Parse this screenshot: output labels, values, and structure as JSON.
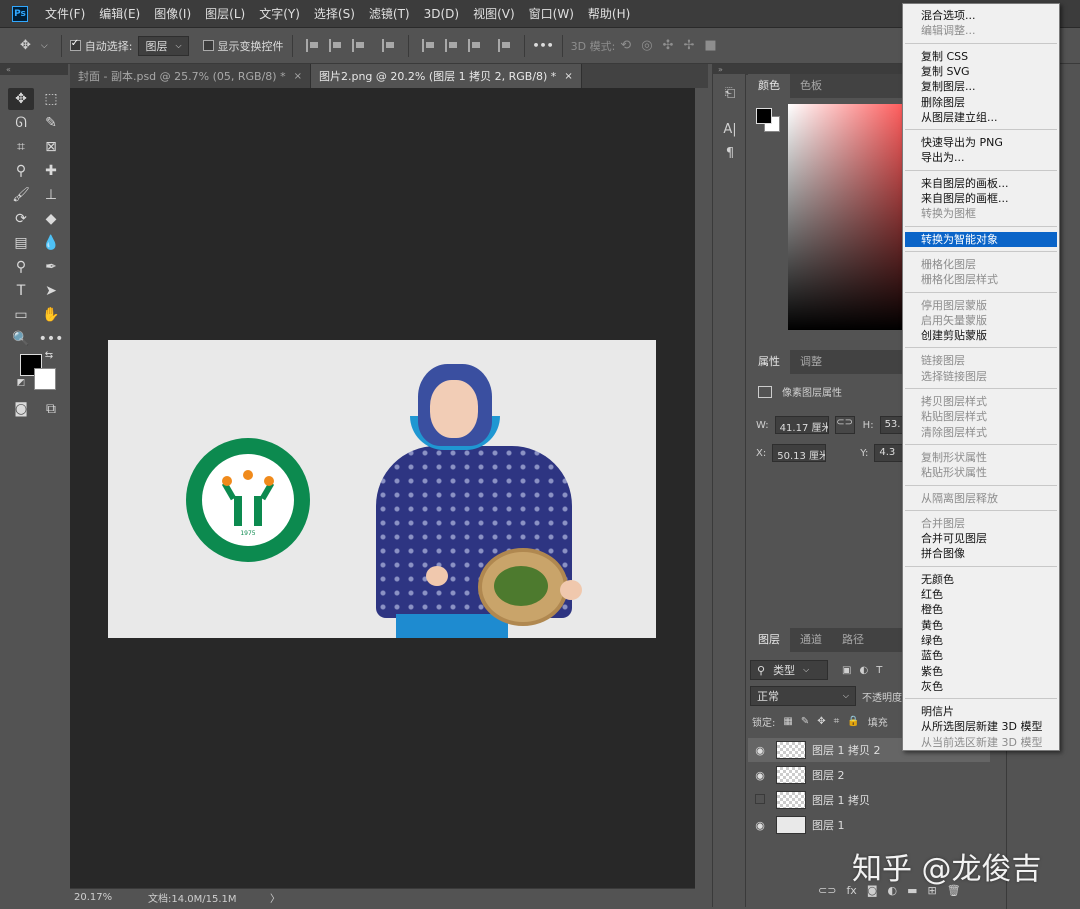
{
  "app": {
    "logo_text": "Ps"
  },
  "menubar": {
    "items": [
      "文件(F)",
      "编辑(E)",
      "图像(I)",
      "图层(L)",
      "文字(Y)",
      "选择(S)",
      "滤镜(T)",
      "3D(D)",
      "视图(V)",
      "窗口(W)",
      "帮助(H)"
    ]
  },
  "options": {
    "auto_select_label": "自动选择:",
    "auto_select_checked": true,
    "target_value": "图层",
    "show_transform_label": "显示变换控件",
    "show_transform_checked": false,
    "more_label": "•••",
    "mode_3d_label": "3D 模式:"
  },
  "tabs": [
    {
      "label": "封面 - 副本.psd @ 25.7% (05, RGB/8) *",
      "close": "×",
      "active": false
    },
    {
      "label": "图片2.png @ 20.2% (图层 1 拷贝 2, RGB/8) *",
      "close": "×",
      "active": true
    }
  ],
  "canvas": {
    "seal_year": "1975"
  },
  "status": {
    "zoom": "20.17%",
    "doc_size": "文档:14.0M/15.1M",
    "arrow": "〉"
  },
  "color_panel": {
    "tabs": [
      "颜色",
      "色板"
    ]
  },
  "props_panel": {
    "tabs": [
      "属性",
      "调整"
    ],
    "title": "像素图层属性",
    "w_label": "W:",
    "w_value": "41.17 厘米",
    "h_label": "H:",
    "h_value": "53.",
    "x_label": "X:",
    "x_value": "50.13 厘米",
    "y_label": "Y:",
    "y_value": "4.3"
  },
  "layers_panel": {
    "tabs": [
      "图层",
      "通道",
      "路径"
    ],
    "filter_value": "类型",
    "blend_mode": "正常",
    "opacity_label": "不透明度",
    "lock_label": "锁定:",
    "fill_label": "填充",
    "layers": [
      {
        "name": "图层 1 拷贝 2",
        "visible": true,
        "selected": true
      },
      {
        "name": "图层 2",
        "visible": true,
        "selected": false
      },
      {
        "name": "图层 1 拷贝",
        "visible": false,
        "selected": false
      },
      {
        "name": "图层 1",
        "visible": true,
        "selected": false
      }
    ]
  },
  "context_menu": {
    "items": [
      {
        "label": "混合选项...",
        "disabled": false
      },
      {
        "label": "编辑调整...",
        "disabled": true
      },
      {
        "sep": true
      },
      {
        "label": "复制 CSS",
        "disabled": false
      },
      {
        "label": "复制 SVG",
        "disabled": false
      },
      {
        "label": "复制图层...",
        "disabled": false
      },
      {
        "label": "删除图层",
        "disabled": false
      },
      {
        "label": "从图层建立组...",
        "disabled": false
      },
      {
        "sep": true
      },
      {
        "label": "快速导出为 PNG",
        "disabled": false
      },
      {
        "label": "导出为...",
        "disabled": false
      },
      {
        "sep": true
      },
      {
        "label": "来自图层的画板...",
        "disabled": false
      },
      {
        "label": "来自图层的画框...",
        "disabled": false
      },
      {
        "label": "转换为图框",
        "disabled": true
      },
      {
        "sep": true
      },
      {
        "label": "转换为智能对象",
        "disabled": false,
        "highlighted": true
      },
      {
        "sep": true
      },
      {
        "label": "栅格化图层",
        "disabled": true
      },
      {
        "label": "栅格化图层样式",
        "disabled": true
      },
      {
        "sep": true
      },
      {
        "label": "停用图层蒙版",
        "disabled": true
      },
      {
        "label": "启用矢量蒙版",
        "disabled": true
      },
      {
        "label": "创建剪贴蒙版",
        "disabled": false
      },
      {
        "sep": true
      },
      {
        "label": "链接图层",
        "disabled": true
      },
      {
        "label": "选择链接图层",
        "disabled": true
      },
      {
        "sep": true
      },
      {
        "label": "拷贝图层样式",
        "disabled": true
      },
      {
        "label": "粘贴图层样式",
        "disabled": true
      },
      {
        "label": "清除图层样式",
        "disabled": true
      },
      {
        "sep": true
      },
      {
        "label": "复制形状属性",
        "disabled": true
      },
      {
        "label": "粘贴形状属性",
        "disabled": true
      },
      {
        "sep": true
      },
      {
        "label": "从隔离图层释放",
        "disabled": true
      },
      {
        "sep": true
      },
      {
        "label": "合并图层",
        "disabled": true
      },
      {
        "label": "合并可见图层",
        "disabled": false
      },
      {
        "label": "拼合图像",
        "disabled": false
      },
      {
        "sep": true
      },
      {
        "label": "无颜色",
        "disabled": false
      },
      {
        "label": "红色",
        "disabled": false
      },
      {
        "label": "橙色",
        "disabled": false
      },
      {
        "label": "黄色",
        "disabled": false
      },
      {
        "label": "绿色",
        "disabled": false
      },
      {
        "label": "蓝色",
        "disabled": false
      },
      {
        "label": "紫色",
        "disabled": false
      },
      {
        "label": "灰色",
        "disabled": false
      },
      {
        "sep": true
      },
      {
        "label": "明信片",
        "disabled": false
      },
      {
        "label": "从所选图层新建 3D 模型",
        "disabled": false
      },
      {
        "label": "从当前选区新建 3D 模型",
        "disabled": true
      }
    ]
  },
  "watermark": "知乎 @龙俊吉",
  "colors": {
    "highlight": "#0a64c8",
    "seal_green": "#0c8a4f",
    "canvas_bg": "#282828"
  }
}
